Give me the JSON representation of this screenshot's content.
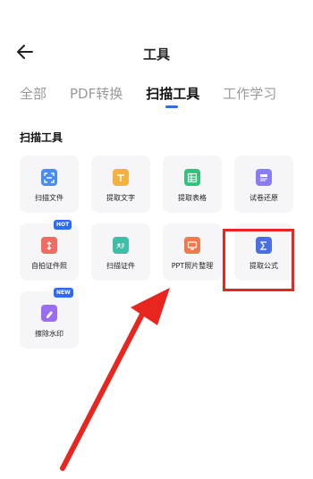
{
  "header": {
    "title": "工具"
  },
  "tabs": [
    {
      "label": "全部",
      "active": false
    },
    {
      "label": "PDF转换",
      "active": false
    },
    {
      "label": "扫描工具",
      "active": true
    },
    {
      "label": "工作学习",
      "active": false
    }
  ],
  "section": {
    "title": "扫描工具"
  },
  "tools": [
    {
      "label": "扫描文件",
      "icon": "scan-file-icon",
      "color": "#4a8cf7",
      "badge": ""
    },
    {
      "label": "提取文字",
      "icon": "extract-text-icon",
      "color": "#f4b13e",
      "badge": ""
    },
    {
      "label": "提取表格",
      "icon": "extract-table-icon",
      "color": "#36c07a",
      "badge": ""
    },
    {
      "label": "试卷还原",
      "icon": "exam-restore-icon",
      "color": "#8a7cf1",
      "badge": ""
    },
    {
      "label": "自拍证件照",
      "icon": "id-photo-icon",
      "color": "#f06b62",
      "badge": "HOT"
    },
    {
      "label": "扫描证件",
      "icon": "scan-id-icon",
      "color": "#3bbfa6",
      "badge": ""
    },
    {
      "label": "PPT照片整理",
      "icon": "ppt-photo-icon",
      "color": "#f0794e",
      "badge": ""
    },
    {
      "label": "提取公式",
      "icon": "extract-formula-icon",
      "color": "#4a6fe0",
      "badge": ""
    },
    {
      "label": "擦除水印",
      "icon": "erase-watermark-icon",
      "color": "#9b6df0",
      "badge": "NEW"
    }
  ],
  "colors": {
    "accent": "#2b6cf6",
    "annotation": "#e8261f"
  }
}
